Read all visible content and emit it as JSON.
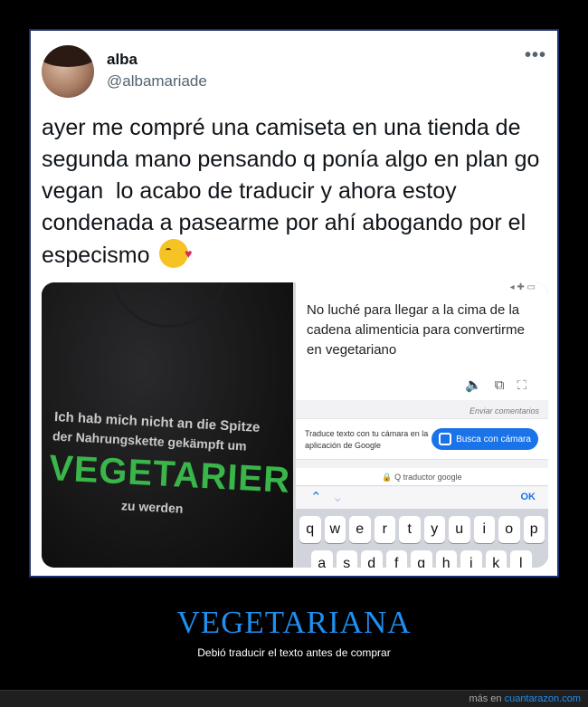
{
  "tweet": {
    "name": "alba",
    "handle": "@albamariade",
    "more": "•••",
    "text": "ayer me compré una camiseta en una tienda de segunda mano pensando q ponía algo en plan go vegan  lo acabo de traducir y ahora estoy condenada a pasearme por ahí abogando por el especismo"
  },
  "shirt": {
    "line1": "Ich hab mich nicht an die Spitze",
    "line2": "der Nahrungskette gekämpft um",
    "big": "VEGETARIER",
    "line3": "zu werden"
  },
  "translator": {
    "translation": "No luché para llegar a la cima de la cadena alimenticia para convertirme en vegetariano",
    "feedback": "Enviar comentarios",
    "promo": "Traduce texto con tu cámara en la aplicación de Google",
    "camera_button": "Busca con cámara",
    "url": "🔒 Q traductor google",
    "ok": "OK",
    "row1": [
      "q",
      "w",
      "e",
      "r",
      "t",
      "y",
      "u",
      "i",
      "o",
      "p"
    ],
    "row2": [
      "a",
      "s",
      "d",
      "f",
      "g",
      "h",
      "j",
      "k",
      "l"
    ]
  },
  "caption": {
    "title": "VEGETARIANA",
    "subtitle": "Debió traducir el texto antes de comprar"
  },
  "footer": {
    "prefix": "más en",
    "link": "cuantarazon.com"
  }
}
